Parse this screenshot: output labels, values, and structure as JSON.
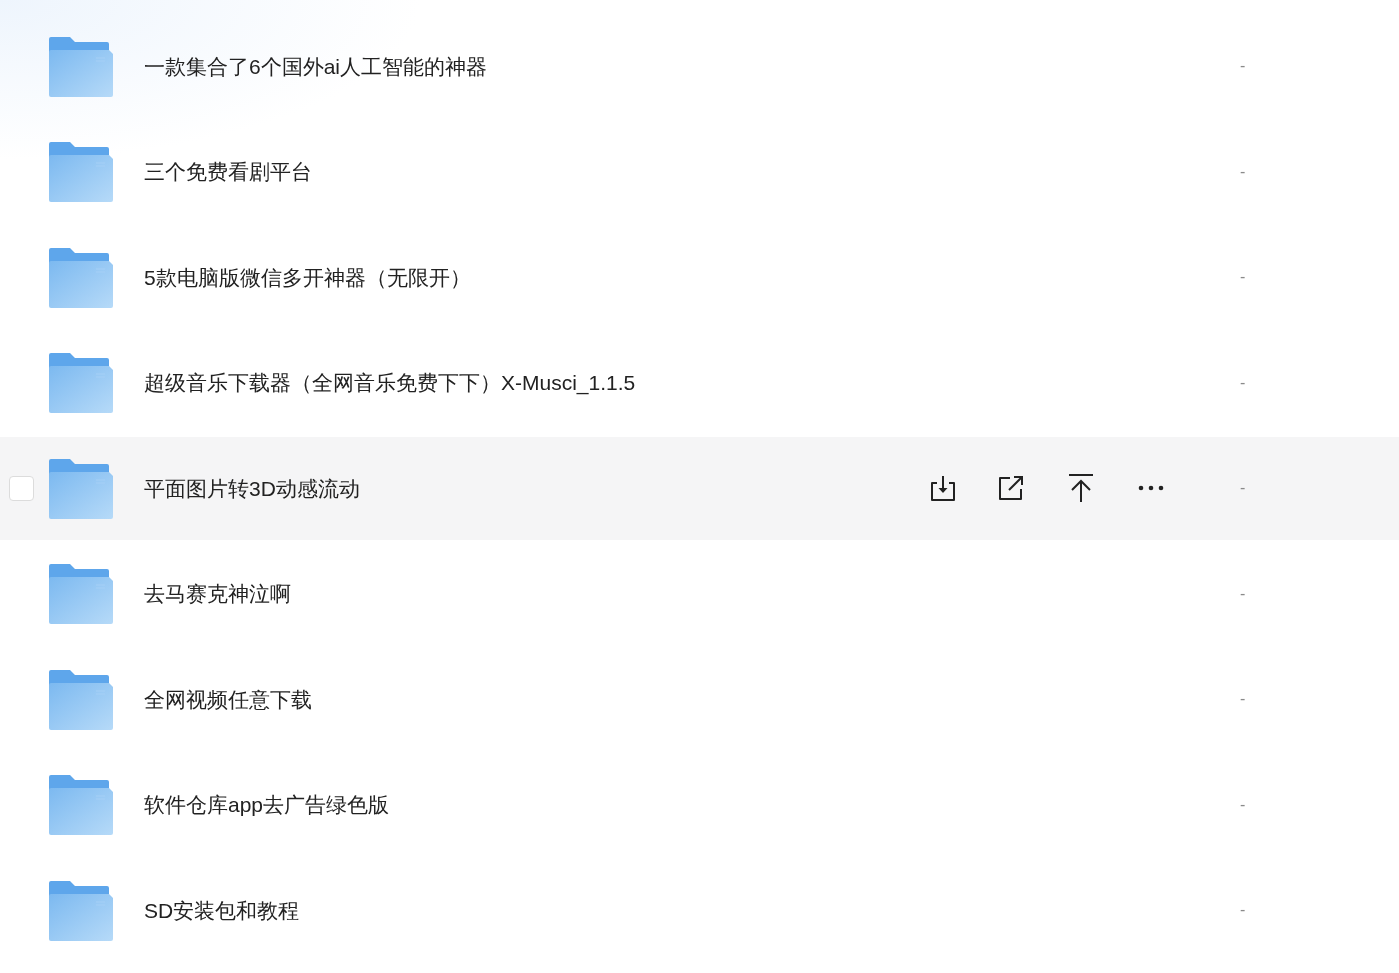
{
  "rows": [
    {
      "name": "一款集合了6个国外ai人工智能的神器",
      "column_2": "-",
      "hovered": false,
      "checked": false
    },
    {
      "name": "三个免费看剧平台",
      "column_2": "-",
      "hovered": false,
      "checked": false
    },
    {
      "name": "5款电脑版微信多开神器（无限开）",
      "column_2": "-",
      "hovered": false,
      "checked": false
    },
    {
      "name": "超级音乐下载器（全网音乐免费下下）X-Musci_1.1.5",
      "column_2": "-",
      "hovered": false,
      "checked": false
    },
    {
      "name": "平面图片转3D动感流动",
      "column_2": "-",
      "hovered": true,
      "checked": false
    },
    {
      "name": "去马赛克神泣啊",
      "column_2": "-",
      "hovered": false,
      "checked": false
    },
    {
      "name": "全网视频任意下载",
      "column_2": "-",
      "hovered": false,
      "checked": false
    },
    {
      "name": "软件仓库app去广告绿色版",
      "column_2": "-",
      "hovered": false,
      "checked": false
    },
    {
      "name": "SD安装包和教程",
      "column_2": "-",
      "hovered": false,
      "checked": false
    }
  ]
}
